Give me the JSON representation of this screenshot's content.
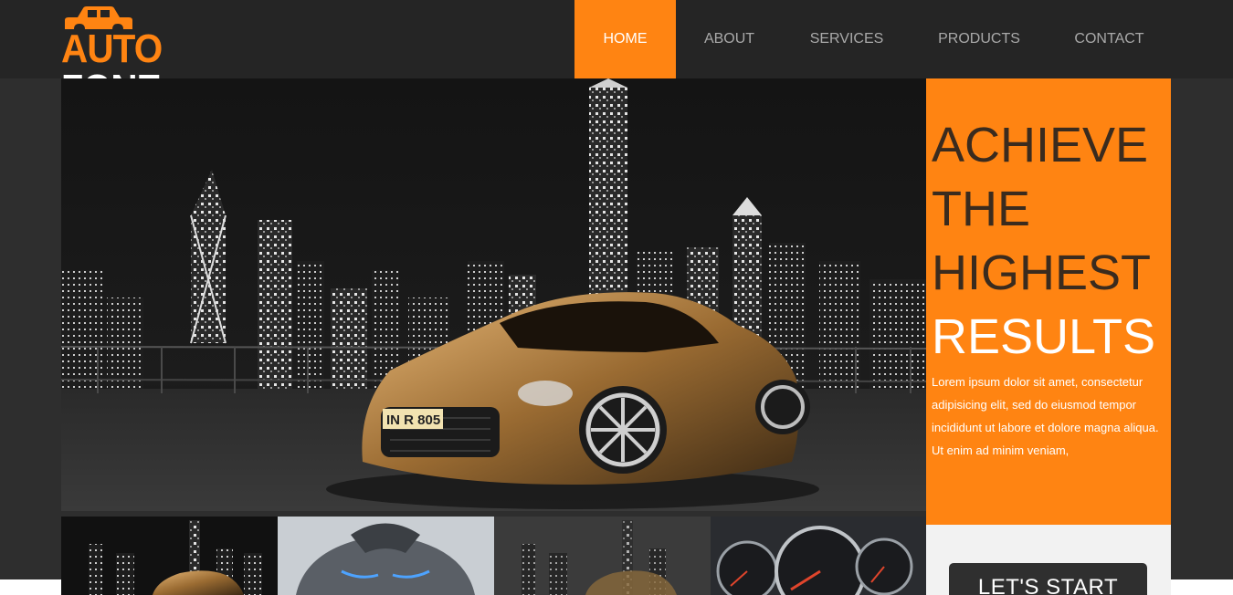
{
  "brand": {
    "auto": "AUTO",
    "zone": "ZONE",
    "accent_color": "#ff8412",
    "icon": "car-icon"
  },
  "nav": {
    "items": [
      {
        "label": "HOME",
        "active": true
      },
      {
        "label": "ABOUT",
        "active": false
      },
      {
        "label": "SERVICES",
        "active": false
      },
      {
        "label": "PRODUCTS",
        "active": false
      },
      {
        "label": "CONTACT",
        "active": false
      }
    ]
  },
  "slider": {
    "plate": "IN R 805"
  },
  "promo": {
    "title_lines": [
      "ACHIEVE",
      "THE",
      "HIGHEST",
      "RESULTS"
    ],
    "text": "Lorem ipsum dolor sit amet, consectetur adipisicing elit, sed do eiusmod tempor incididunt ut labore et dolore magna aliqua. Ut enim ad minim veniam,",
    "cta_label": "LET'S START"
  },
  "thumbnails": [
    {
      "name": "thumb-city-car"
    },
    {
      "name": "thumb-concept-car"
    },
    {
      "name": "thumb-city-car-2"
    },
    {
      "name": "thumb-speedometer"
    }
  ]
}
